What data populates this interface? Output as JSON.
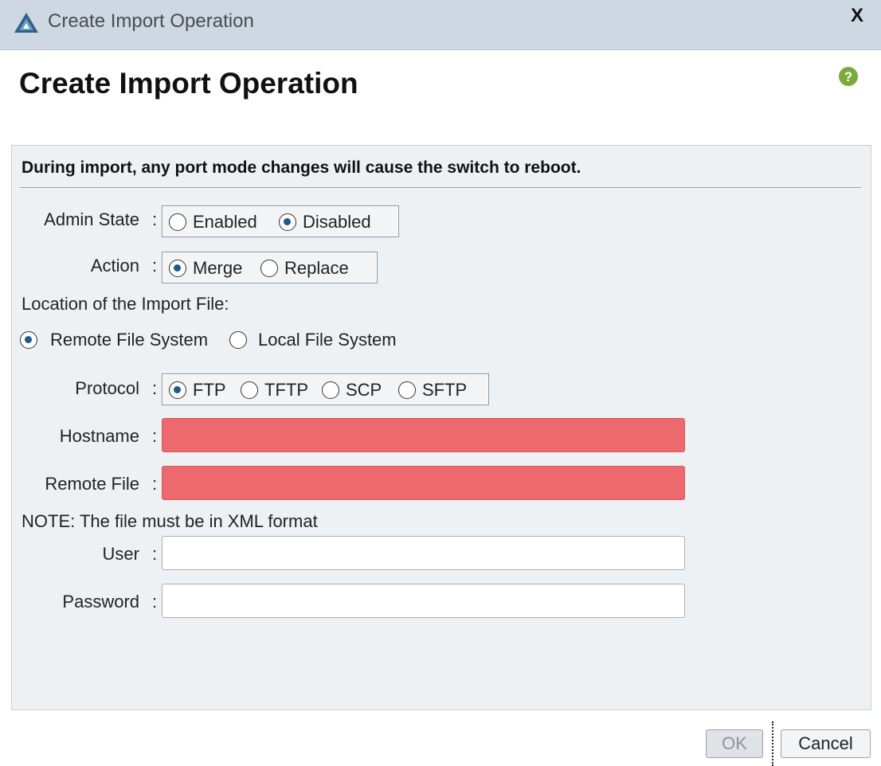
{
  "window": {
    "title": "Create Import Operation",
    "close_label": "X"
  },
  "dialog": {
    "heading": "Create Import Operation",
    "warning": "During import, any port mode changes will cause the switch to reboot."
  },
  "form": {
    "colon": ":",
    "admin_state": {
      "label": "Admin State",
      "options": [
        "Enabled",
        "Disabled"
      ],
      "selected": "Disabled"
    },
    "action": {
      "label": "Action",
      "options": [
        "Merge",
        "Replace"
      ],
      "selected": "Merge"
    },
    "location": {
      "label": "Location of the Import File:",
      "options": [
        "Remote File System",
        "Local File System"
      ],
      "selected": "Remote File System"
    },
    "protocol": {
      "label": "Protocol",
      "options": [
        "FTP",
        "TFTP",
        "SCP",
        "SFTP"
      ],
      "selected": "FTP"
    },
    "hostname": {
      "label": "Hostname",
      "value": "",
      "state": "error"
    },
    "remote_file": {
      "label": "Remote File",
      "value": "",
      "state": "error"
    },
    "note": "NOTE: The file must be in XML format",
    "user": {
      "label": "User",
      "value": ""
    },
    "password": {
      "label": "Password",
      "value": ""
    }
  },
  "buttons": {
    "ok": "OK",
    "cancel": "Cancel"
  },
  "colors": {
    "title_bar": "#cdd8e3",
    "panel": "#eef1f4",
    "error_field": "#ec6a6e",
    "radio_dot": "#1d5a8f",
    "help_icon": "#7aab3a"
  },
  "icons": {
    "app": "app-logo-icon",
    "help": "help-icon",
    "radio_checked": "radio-checked-icon",
    "radio_unchecked": "radio-unchecked-icon"
  }
}
